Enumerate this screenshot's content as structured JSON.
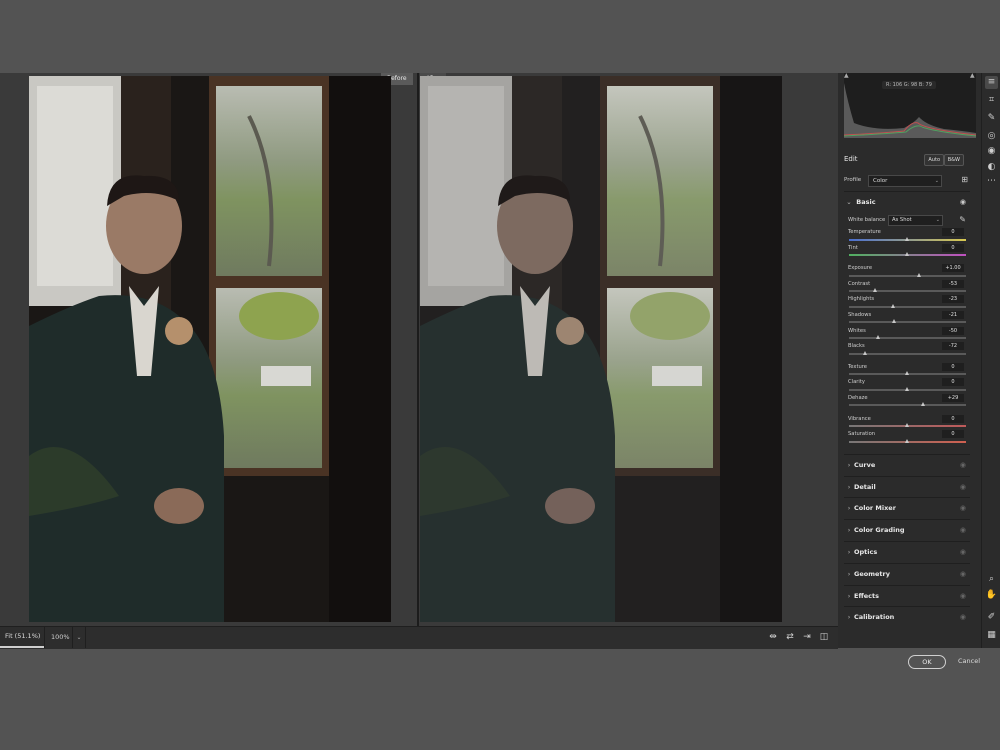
{
  "compare": {
    "before": "Before",
    "after": "After"
  },
  "histogram": {
    "readout": "R: 106   G: 98   B: 79"
  },
  "edit": {
    "title": "Edit",
    "auto": "Auto",
    "bw": "B&W"
  },
  "profile": {
    "label": "Profile",
    "value": "Color"
  },
  "basic": {
    "title": "Basic",
    "white_balance": {
      "label": "White balance",
      "value": "As Shot"
    },
    "groups": [
      [
        {
          "label": "Temperature",
          "value": "0",
          "pos": 0.5,
          "track": "temp"
        },
        {
          "label": "Tint",
          "value": "0",
          "pos": 0.5,
          "track": "tint"
        }
      ],
      [
        {
          "label": "Exposure",
          "value": "+1.00",
          "pos": 0.6,
          "track": "plain"
        },
        {
          "label": "Contrast",
          "value": "-53",
          "pos": 0.23,
          "track": "plain"
        },
        {
          "label": "Highlights",
          "value": "-23",
          "pos": 0.38,
          "track": "plain"
        },
        {
          "label": "Shadows",
          "value": "-21",
          "pos": 0.39,
          "track": "plain"
        },
        {
          "label": "Whites",
          "value": "-50",
          "pos": 0.25,
          "track": "plain"
        },
        {
          "label": "Blacks",
          "value": "-72",
          "pos": 0.14,
          "track": "plain"
        }
      ],
      [
        {
          "label": "Texture",
          "value": "0",
          "pos": 0.5,
          "track": "plain"
        },
        {
          "label": "Clarity",
          "value": "0",
          "pos": 0.5,
          "track": "plain"
        },
        {
          "label": "Dehaze",
          "value": "+29",
          "pos": 0.64,
          "track": "plain"
        }
      ],
      [
        {
          "label": "Vibrance",
          "value": "0",
          "pos": 0.5,
          "track": "vib"
        },
        {
          "label": "Saturation",
          "value": "0",
          "pos": 0.5,
          "track": "sat"
        }
      ]
    ]
  },
  "sections": [
    "Curve",
    "Detail",
    "Color Mixer",
    "Color Grading",
    "Optics",
    "Geometry",
    "Effects",
    "Calibration"
  ],
  "zoom": {
    "fit": "Fit (51.1%)",
    "actual": "100%"
  },
  "footer": {
    "ok": "OK",
    "cancel": "Cancel"
  },
  "colors": {
    "accent": "#d0d0d0",
    "panel": "#2b2b2b",
    "backdrop": "#535353"
  }
}
